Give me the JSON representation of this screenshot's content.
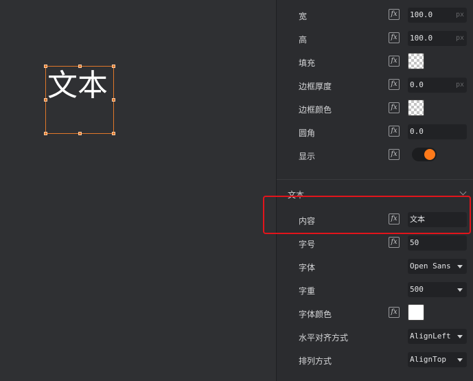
{
  "canvas": {
    "element_text": "文本"
  },
  "properties": [
    {
      "label": "宽",
      "fx": true,
      "kind": "number",
      "value": "100.0",
      "unit": "px"
    },
    {
      "label": "高",
      "fx": true,
      "kind": "number",
      "value": "100.0",
      "unit": "px"
    },
    {
      "label": "填充",
      "fx": true,
      "kind": "color",
      "color": "transparent"
    },
    {
      "label": "边框厚度",
      "fx": true,
      "kind": "number",
      "value": "0.0",
      "unit": "px"
    },
    {
      "label": "边框颜色",
      "fx": true,
      "kind": "color",
      "color": "transparent"
    },
    {
      "label": "圆角",
      "fx": true,
      "kind": "number",
      "value": "0.0",
      "unit": ""
    },
    {
      "label": "显示",
      "fx": true,
      "kind": "toggle",
      "on": true
    }
  ],
  "text_section": {
    "title": "文本",
    "rows": [
      {
        "label": "内容",
        "fx": true,
        "kind": "text",
        "value": "文本"
      },
      {
        "label": "字号",
        "fx": true,
        "kind": "text",
        "value": "50"
      },
      {
        "label": "字体",
        "fx": false,
        "kind": "select",
        "value": "Open Sans"
      },
      {
        "label": "字重",
        "fx": false,
        "kind": "select",
        "value": "500"
      },
      {
        "label": "字体颜色",
        "fx": true,
        "kind": "color",
        "color": "#ffffff"
      },
      {
        "label": "水平对齐方式",
        "fx": false,
        "kind": "select",
        "value": "AlignLeft"
      },
      {
        "label": "排列方式",
        "fx": false,
        "kind": "select",
        "value": "AlignTop"
      }
    ]
  },
  "fx_glyph": "fx",
  "colors": {
    "accent": "#ff7a1a",
    "selection": "#e2782a",
    "highlight": "#e3141b"
  }
}
